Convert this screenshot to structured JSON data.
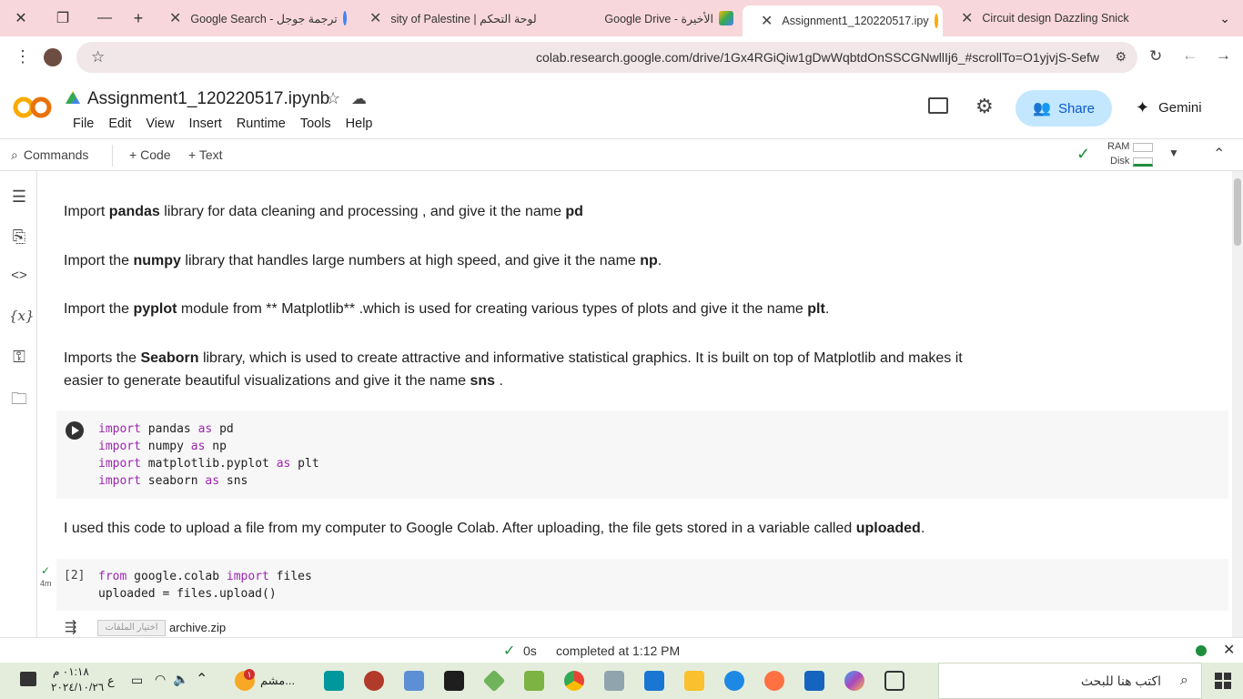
{
  "browser": {
    "tabs": [
      {
        "label": "Google Search - ترجمة جوجل",
        "active": false
      },
      {
        "label": "sity of Palestine | لوحة التحكم",
        "active": false
      },
      {
        "label": "Google Drive - الأخيرة",
        "active": false
      },
      {
        "label": "Assignment1_120220517.ipy",
        "active": true
      },
      {
        "label": "Circuit design Dazzling Snick",
        "active": false
      }
    ],
    "url": "colab.research.google.com/drive/1Gx4RGiQiw1gDwWqbtdOnSSCGNwllIj6_#scrollTo=O1yjvjS-Sefw"
  },
  "colab": {
    "notebook_title": "Assignment1_120220517.ipynb",
    "menu": [
      "File",
      "Edit",
      "View",
      "Insert",
      "Runtime",
      "Tools",
      "Help"
    ],
    "share_label": "Share",
    "gemini_label": "Gemini",
    "toolbar": {
      "commands": "Commands",
      "code": "Code",
      "text": "Text",
      "ram": "RAM",
      "disk": "Disk"
    }
  },
  "cells": {
    "md1": {
      "a": "Import ",
      "b": "pandas",
      "c": " library for data cleaning and processing , and give it the name ",
      "d": "pd"
    },
    "md2": {
      "a": "Import the ",
      "b": "numpy",
      "c": " library that handles large numbers at high speed, and give it the name ",
      "d": "np",
      "e": "."
    },
    "md3": {
      "a": "Import the ",
      "b": "pyplot",
      "c": " module from ** Matplotlib** .which is used for creating various types of plots and give it the name ",
      "d": "plt",
      "e": "."
    },
    "md4": {
      "a": "Imports the ",
      "b": "Seaborn",
      "c": " library, which is used to create attractive and informative statistical graphics. It is built on top of Matplotlib and makes it",
      "c2": "easier to generate beautiful visualizations and give it the name ",
      "d": "sns",
      "e": " ."
    },
    "code1": [
      {
        "kw": "import",
        "t1": " pandas ",
        "kw2": "as",
        "t2": " pd"
      },
      {
        "kw": "import",
        "t1": " numpy ",
        "kw2": "as",
        "t2": " np"
      },
      {
        "kw": "import",
        "t1": " matplotlib.pyplot ",
        "kw2": "as",
        "t2": " plt"
      },
      {
        "kw": "import",
        "t1": " seaborn ",
        "kw2": "as",
        "t2": " sns"
      }
    ],
    "md5": {
      "a": "I used this code to upload a file from my computer to Google Colab. After uploading, the file gets stored in a variable called ",
      "b": "uploaded",
      "c": "."
    },
    "code2": {
      "exec_count": "[2]",
      "time": "4m",
      "line1_kw": "from",
      "line1_a": " google.colab ",
      "line1_kw2": "import",
      "line1_b": " files",
      "line2": "uploaded = files.upload()"
    },
    "output": {
      "button": "اختيار الملفات",
      "file": "archive.zip"
    }
  },
  "status": {
    "time": "0s",
    "text": "completed at 1:12 PM"
  },
  "taskbar": {
    "search_placeholder": "اكتب هنا للبحث",
    "clock_time": "٠١:١٨ م",
    "clock_date": "٢٠٢٤/١٠/٢٦",
    "lang": "ع",
    "weather": "مشم...",
    "notif": "١"
  }
}
